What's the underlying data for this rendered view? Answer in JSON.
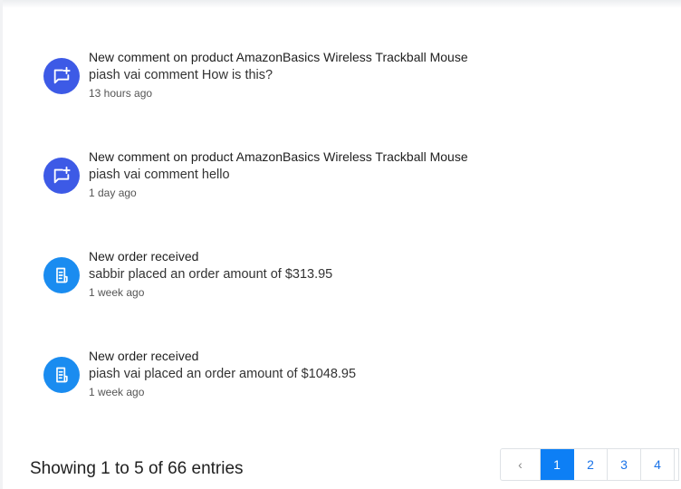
{
  "notifications": [
    {
      "type": "comment",
      "icon": "comment-add-icon",
      "title": "New comment on product AmazonBasics Wireless Trackball Mouse",
      "message": "piash vai comment How is this?",
      "time": "13 hours ago"
    },
    {
      "type": "comment",
      "icon": "comment-add-icon",
      "title": "New comment on product AmazonBasics Wireless Trackball Mouse",
      "message": "piash vai comment hello",
      "time": "1 day ago"
    },
    {
      "type": "order",
      "icon": "order-document-icon",
      "title": "New order received",
      "message": "sabbir placed an order amount of $313.95",
      "time": "1 week ago"
    },
    {
      "type": "order",
      "icon": "order-document-icon",
      "title": "New order received",
      "message": "piash vai placed an order amount of $1048.95",
      "time": "1 week ago"
    }
  ],
  "footer": {
    "entries_text": "Showing 1 to 5 of 66 entries"
  },
  "pagination": {
    "prev_label": "‹",
    "pages": [
      "1",
      "2",
      "3",
      "4"
    ],
    "active_page": "1"
  },
  "colors": {
    "comment_icon_bg": "#3d5ae6",
    "order_icon_bg": "#1a8cf0",
    "active_page_bg": "#0d7ff5"
  }
}
